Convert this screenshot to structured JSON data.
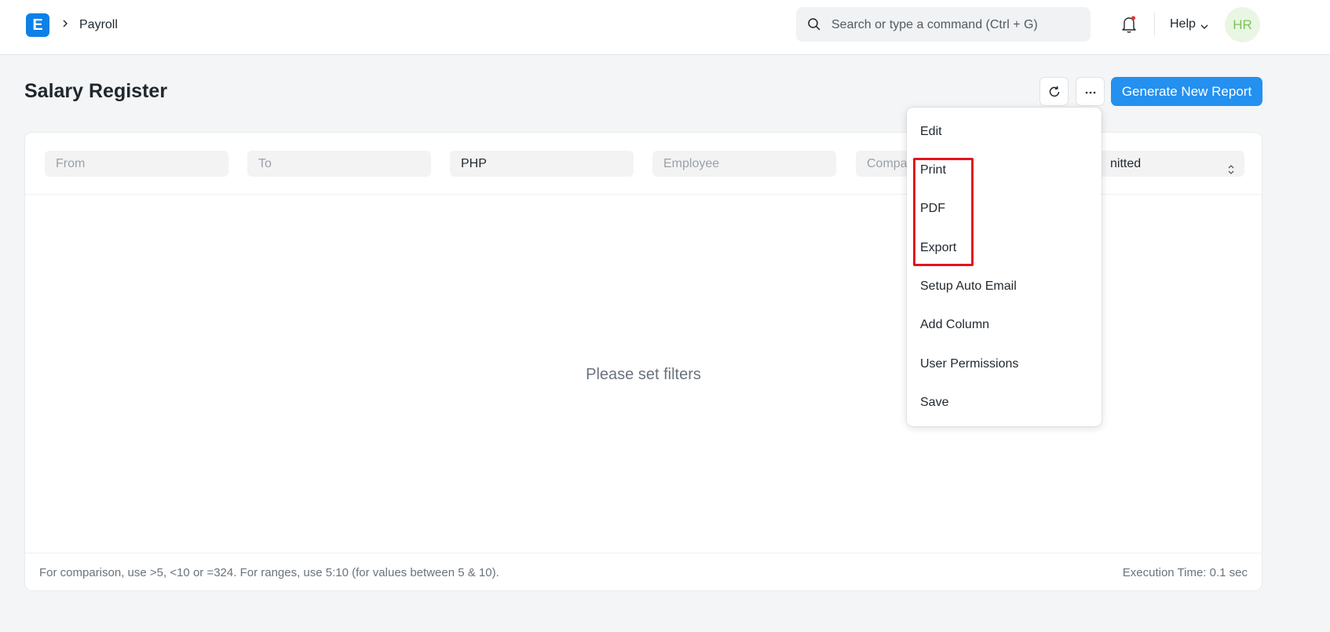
{
  "navbar": {
    "logo_letter": "E",
    "breadcrumb": "Payroll",
    "search_placeholder": "Search or type a command (Ctrl + G)",
    "help_label": "Help",
    "avatar_initials": "HR"
  },
  "page": {
    "title": "Salary Register",
    "primary_button": "Generate New Report"
  },
  "filters": {
    "from_placeholder": "From",
    "to_placeholder": "To",
    "currency_value": "PHP",
    "employee_placeholder": "Employee",
    "company_placeholder": "Compa",
    "docstatus_value": "nitted"
  },
  "content": {
    "empty_message": "Please set filters"
  },
  "footer": {
    "hint": "For comparison, use >5, <10 or =324. For ranges, use 5:10 (for values between 5 & 10).",
    "execution_time": "Execution Time: 0.1 sec"
  },
  "menu": {
    "items": [
      "Edit",
      "Print",
      "PDF",
      "Export",
      "Setup Auto Email",
      "Add Column",
      "User Permissions",
      "Save"
    ]
  },
  "colors": {
    "primary": "#2490ef",
    "logo": "#0d81e8",
    "highlight": "#e3141e"
  }
}
